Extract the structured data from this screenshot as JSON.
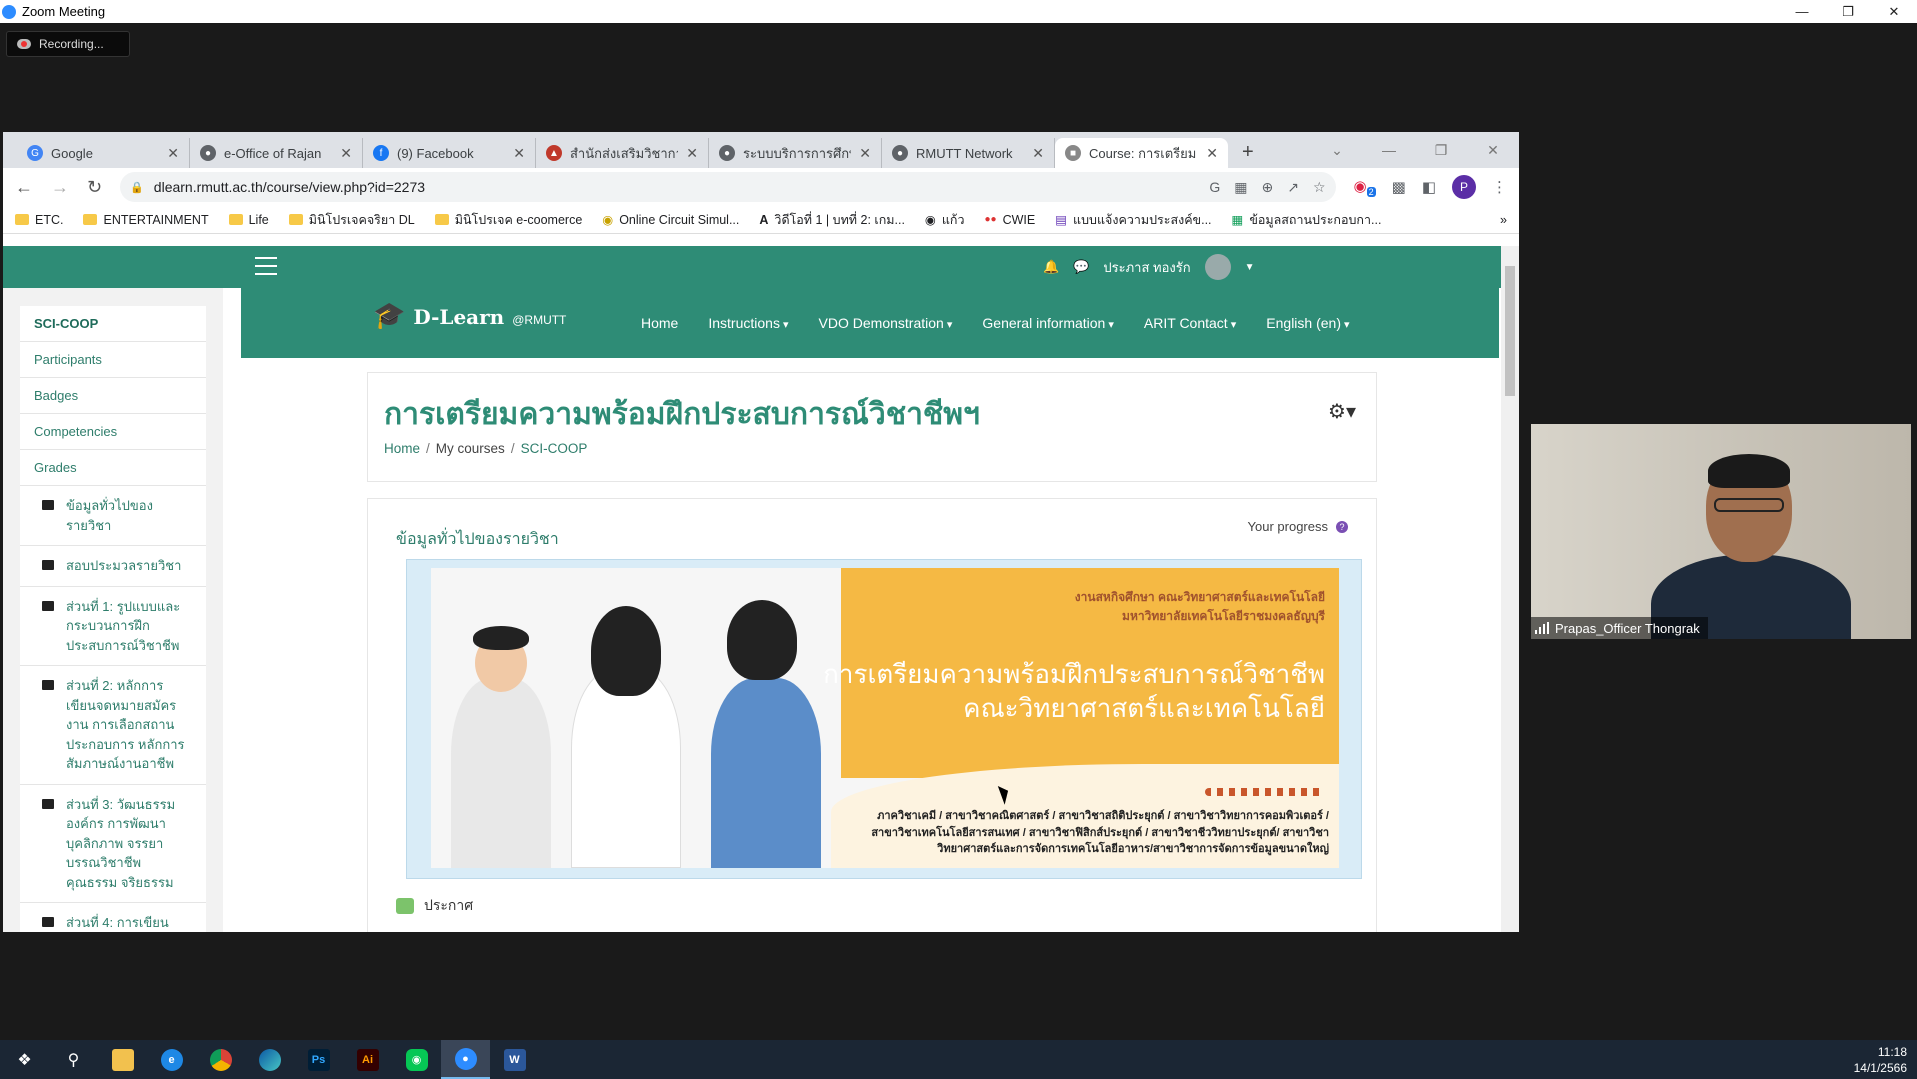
{
  "zoom": {
    "title": "Zoom Meeting",
    "recording": "Recording..."
  },
  "browser": {
    "tabs": [
      {
        "label": "Google",
        "icon": "google-icon",
        "color": "#4285f4"
      },
      {
        "label": "e-Office of Rajan",
        "icon": "globe-icon",
        "color": "#5f6368"
      },
      {
        "label": "(9) Facebook",
        "icon": "facebook-icon",
        "color": "#1877f2"
      },
      {
        "label": "สำนักส่งเสริมวิชาการ",
        "icon": "office-icon",
        "color": "#c0392b"
      },
      {
        "label": "ระบบบริการการศึกษ",
        "icon": "globe-icon",
        "color": "#5f6368"
      },
      {
        "label": "RMUTT Network",
        "icon": "globe-icon",
        "color": "#5f6368"
      },
      {
        "label": "Course: การเตรียม",
        "icon": "moodle-icon",
        "color": "#888888"
      }
    ],
    "url": "dlearn.rmutt.ac.th/course/view.php?id=2273",
    "profile_initial": "P",
    "ext_badge": "2",
    "bookmarks": [
      "ETC.",
      "ENTERTAINMENT",
      "Life",
      "มินิโปรเจคจริยา DL",
      "มินิโปรเจค e-coomerce",
      "Online Circuit Simul...",
      "วิดีโอที่ 1 | บทที่ 2: เกม...",
      "แก้ว",
      "CWIE",
      "แบบแจ้งความประสงค์ข...",
      "ข้อมูลสถานประกอบกา..."
    ]
  },
  "moodle": {
    "user_name": "ประภาส ทองรัก",
    "brand_name": "D-Learn",
    "brand_sub": "@RMUTT",
    "menu": [
      "Home",
      "Instructions",
      "VDO Demonstration",
      "General information",
      "ARIT Contact",
      "English (en)"
    ],
    "sidebar": {
      "course": "SCI-COOP",
      "links": [
        "Participants",
        "Badges",
        "Competencies",
        "Grades"
      ],
      "sections": [
        "ข้อมูลทั่วไปของรายวิชา",
        "สอบประมวลรายวิชา",
        "ส่วนที่ 1: รูปแบบและกระบวนการฝึกประสบการณ์วิชาชีพ",
        "ส่วนที่ 2: หลักการเขียนจดหมายสมัครงาน การเลือกสถานประกอบการ หลักการสัมภาษณ์งานอาชีพ",
        "ส่วนที่ 3: วัฒนธรรมองค์กร การพัฒนาบุคลิกภาพ จรรยาบรรณวิชาชีพ คุณธรรม จริยธรรม",
        "ส่วนที่ 4: การเขียน"
      ]
    },
    "page_title": "การเตรียมความพร้อมฝึกประสบการณ์วิชาชีพฯ",
    "breadcrumb": [
      "Home",
      "My courses",
      "SCI-COOP"
    ],
    "section_title": "ข้อมูลทั่วไปของรายวิชา",
    "progress_label": "Your progress",
    "banner": {
      "org_line1": "งานสหกิจศึกษา คณะวิทยาศาสตร์และเทคโนโลยี",
      "org_line2": "มหาวิทยาลัยเทคโนโลยีราชมงคลธัญบุรี",
      "title_line1": "การเตรียมความพร้อมฝึกประสบการณ์วิชาชีพ",
      "title_line2": "คณะวิทยาศาสตร์และเทคโนโลยี",
      "depts": "ภาควิชาเคมี / สาขาวิชาคณิตศาสตร์ / สาขาวิชาสถิติประยุกต์ / สาขาวิชาวิทยาการคอมพิวเตอร์ / สาขาวิชาเทคโนโลยีสารสนเทศ / สาขาวิชาฟิสิกส์ประยุกต์ / สาขาวิชาชีววิทยาประยุกต์/ สาขาวิชาวิทยาศาสตร์และการจัดการเทคโนโลยีอาหาร/สาขาวิชาการจัดการข้อมูลขนาดใหญ่"
    },
    "announcement": "ประกาศ"
  },
  "video": {
    "participant": "Prapas_Officer Thongrak"
  },
  "clock": {
    "time": "11:18",
    "date": "14/1/2566"
  },
  "colors": {
    "moodle_green": "#2e8c76",
    "banner_orange": "#f5b944"
  }
}
